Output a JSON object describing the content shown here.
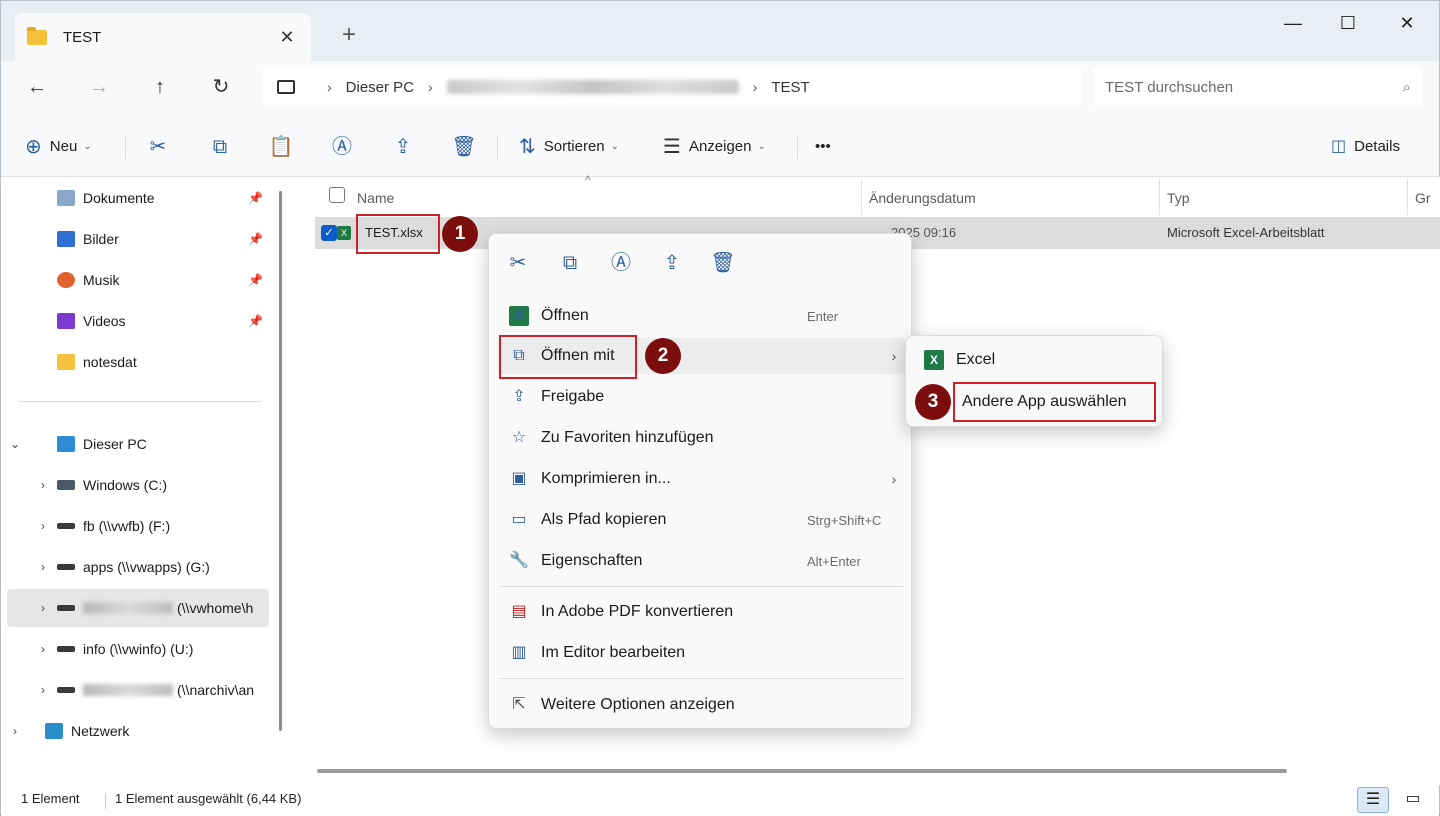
{
  "window": {
    "tab_title": "TEST",
    "new_tab": "+",
    "minimize": "—",
    "maximize": "☐",
    "close": "✕"
  },
  "address": {
    "crumbs": [
      "Dieser PC",
      "TEST"
    ],
    "search_placeholder": "TEST durchsuchen"
  },
  "commands": {
    "new_label": "Neu",
    "sort_label": "Sortieren",
    "view_label": "Anzeigen",
    "more": "•••",
    "details_label": "Details"
  },
  "sidebar": {
    "quick_access": [
      {
        "label": "Dokumente",
        "icon": "documents-icon"
      },
      {
        "label": "Bilder",
        "icon": "pictures-icon"
      },
      {
        "label": "Musik",
        "icon": "music-icon"
      },
      {
        "label": "Videos",
        "icon": "videos-icon"
      },
      {
        "label": "notesdat",
        "icon": "folder-icon"
      }
    ],
    "this_pc": "Dieser PC",
    "drives": [
      {
        "label": "Windows (C:)"
      },
      {
        "label": "fb (\\\\vwfb) (F:)"
      },
      {
        "label": "apps (\\\\vwapps) (G:)"
      },
      {
        "label": "(\\\\vwhome\\h"
      },
      {
        "label": "info (\\\\vwinfo) (U:)"
      },
      {
        "label": "(\\\\narchiv\\an"
      }
    ],
    "network": "Netzwerk"
  },
  "columns": {
    "name": "Name",
    "date": "Änderungsdatum",
    "type": "Typ",
    "size": "Gr"
  },
  "file": {
    "name": "TEST.xlsx",
    "date": "2025 09:16",
    "type": "Microsoft Excel-Arbeitsblatt"
  },
  "context_menu": {
    "items": [
      {
        "label": "Öffnen",
        "shortcut": "Enter"
      },
      {
        "label": "Öffnen mit",
        "submenu": true
      },
      {
        "label": "Freigabe"
      },
      {
        "label": "Zu Favoriten hinzufügen"
      },
      {
        "label": "Komprimieren in...",
        "submenu": true
      },
      {
        "label": "Als Pfad kopieren",
        "shortcut": "Strg+Shift+C"
      },
      {
        "label": "Eigenschaften",
        "shortcut": "Alt+Enter"
      },
      {
        "label": "In Adobe PDF konvertieren"
      },
      {
        "label": "Im Editor bearbeiten"
      },
      {
        "label": "Weitere Optionen anzeigen"
      }
    ]
  },
  "submenu": {
    "excel": "Excel",
    "choose_app": "Andere App auswählen"
  },
  "badges": [
    "1",
    "2",
    "3"
  ],
  "status": {
    "count": "1 Element",
    "selected": "1 Element ausgewählt (6,44 KB)"
  },
  "colors": {
    "highlight_red": "#d0202a",
    "badge_darkred": "#7c0d0d",
    "accent_blue": "#0a5cc8",
    "excel_green": "#1f7a45"
  }
}
